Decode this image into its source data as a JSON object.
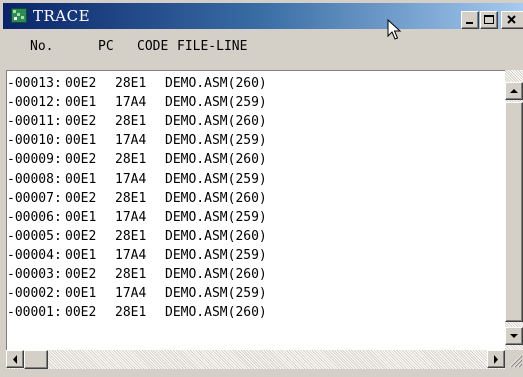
{
  "window": {
    "title": "TRACE",
    "title_icon": "app-icon",
    "title_bar_color": "#0a246a",
    "controls": [
      "minimize-icon",
      "maximize-icon",
      "close-icon"
    ]
  },
  "table": {
    "headers": [
      "No.",
      "PC",
      "CODE",
      "FILE-LINE"
    ],
    "rows": [
      {
        "no": "-00013:",
        "pc": "00E2",
        "code": "28E1",
        "file_line": "DEMO.ASM(260)"
      },
      {
        "no": "-00012:",
        "pc": "00E1",
        "code": "17A4",
        "file_line": "DEMO.ASM(259)"
      },
      {
        "no": "-00011:",
        "pc": "00E2",
        "code": "28E1",
        "file_line": "DEMO.ASM(260)"
      },
      {
        "no": "-00010:",
        "pc": "00E1",
        "code": "17A4",
        "file_line": "DEMO.ASM(259)"
      },
      {
        "no": "-00009:",
        "pc": "00E2",
        "code": "28E1",
        "file_line": "DEMO.ASM(260)"
      },
      {
        "no": "-00008:",
        "pc": "00E1",
        "code": "17A4",
        "file_line": "DEMO.ASM(259)"
      },
      {
        "no": "-00007:",
        "pc": "00E2",
        "code": "28E1",
        "file_line": "DEMO.ASM(260)"
      },
      {
        "no": "-00006:",
        "pc": "00E1",
        "code": "17A4",
        "file_line": "DEMO.ASM(259)"
      },
      {
        "no": "-00005:",
        "pc": "00E2",
        "code": "28E1",
        "file_line": "DEMO.ASM(260)"
      },
      {
        "no": "-00004:",
        "pc": "00E1",
        "code": "17A4",
        "file_line": "DEMO.ASM(259)"
      },
      {
        "no": "-00003:",
        "pc": "00E2",
        "code": "28E1",
        "file_line": "DEMO.ASM(260)"
      },
      {
        "no": "-00002:",
        "pc": "00E1",
        "code": "17A4",
        "file_line": "DEMO.ASM(259)"
      },
      {
        "no": "-00001:",
        "pc": "00E2",
        "code": "28E1",
        "file_line": "DEMO.ASM(260)"
      }
    ]
  },
  "scrollbars": {
    "vertical_icons": [
      "scroll-up-arrow-icon",
      "scroll-down-arrow-icon"
    ],
    "horizontal_icons": [
      "scroll-left-arrow-icon",
      "scroll-right-arrow-icon"
    ]
  }
}
